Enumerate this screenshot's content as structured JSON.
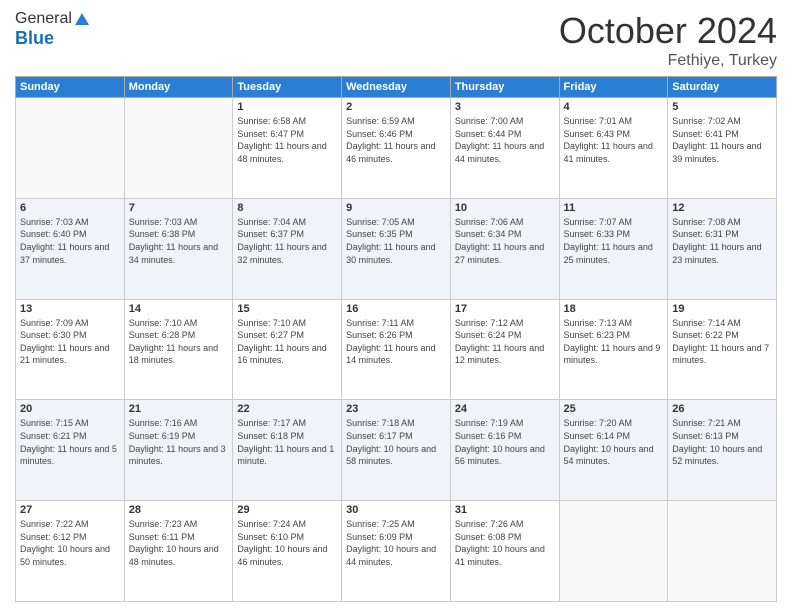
{
  "logo": {
    "line1": "General",
    "line2": "Blue"
  },
  "header": {
    "month": "October 2024",
    "location": "Fethiye, Turkey"
  },
  "weekdays": [
    "Sunday",
    "Monday",
    "Tuesday",
    "Wednesday",
    "Thursday",
    "Friday",
    "Saturday"
  ],
  "weeks": [
    [
      {
        "day": "",
        "info": ""
      },
      {
        "day": "",
        "info": ""
      },
      {
        "day": "1",
        "info": "Sunrise: 6:58 AM\nSunset: 6:47 PM\nDaylight: 11 hours and 48 minutes."
      },
      {
        "day": "2",
        "info": "Sunrise: 6:59 AM\nSunset: 6:46 PM\nDaylight: 11 hours and 46 minutes."
      },
      {
        "day": "3",
        "info": "Sunrise: 7:00 AM\nSunset: 6:44 PM\nDaylight: 11 hours and 44 minutes."
      },
      {
        "day": "4",
        "info": "Sunrise: 7:01 AM\nSunset: 6:43 PM\nDaylight: 11 hours and 41 minutes."
      },
      {
        "day": "5",
        "info": "Sunrise: 7:02 AM\nSunset: 6:41 PM\nDaylight: 11 hours and 39 minutes."
      }
    ],
    [
      {
        "day": "6",
        "info": "Sunrise: 7:03 AM\nSunset: 6:40 PM\nDaylight: 11 hours and 37 minutes."
      },
      {
        "day": "7",
        "info": "Sunrise: 7:03 AM\nSunset: 6:38 PM\nDaylight: 11 hours and 34 minutes."
      },
      {
        "day": "8",
        "info": "Sunrise: 7:04 AM\nSunset: 6:37 PM\nDaylight: 11 hours and 32 minutes."
      },
      {
        "day": "9",
        "info": "Sunrise: 7:05 AM\nSunset: 6:35 PM\nDaylight: 11 hours and 30 minutes."
      },
      {
        "day": "10",
        "info": "Sunrise: 7:06 AM\nSunset: 6:34 PM\nDaylight: 11 hours and 27 minutes."
      },
      {
        "day": "11",
        "info": "Sunrise: 7:07 AM\nSunset: 6:33 PM\nDaylight: 11 hours and 25 minutes."
      },
      {
        "day": "12",
        "info": "Sunrise: 7:08 AM\nSunset: 6:31 PM\nDaylight: 11 hours and 23 minutes."
      }
    ],
    [
      {
        "day": "13",
        "info": "Sunrise: 7:09 AM\nSunset: 6:30 PM\nDaylight: 11 hours and 21 minutes."
      },
      {
        "day": "14",
        "info": "Sunrise: 7:10 AM\nSunset: 6:28 PM\nDaylight: 11 hours and 18 minutes."
      },
      {
        "day": "15",
        "info": "Sunrise: 7:10 AM\nSunset: 6:27 PM\nDaylight: 11 hours and 16 minutes."
      },
      {
        "day": "16",
        "info": "Sunrise: 7:11 AM\nSunset: 6:26 PM\nDaylight: 11 hours and 14 minutes."
      },
      {
        "day": "17",
        "info": "Sunrise: 7:12 AM\nSunset: 6:24 PM\nDaylight: 11 hours and 12 minutes."
      },
      {
        "day": "18",
        "info": "Sunrise: 7:13 AM\nSunset: 6:23 PM\nDaylight: 11 hours and 9 minutes."
      },
      {
        "day": "19",
        "info": "Sunrise: 7:14 AM\nSunset: 6:22 PM\nDaylight: 11 hours and 7 minutes."
      }
    ],
    [
      {
        "day": "20",
        "info": "Sunrise: 7:15 AM\nSunset: 6:21 PM\nDaylight: 11 hours and 5 minutes."
      },
      {
        "day": "21",
        "info": "Sunrise: 7:16 AM\nSunset: 6:19 PM\nDaylight: 11 hours and 3 minutes."
      },
      {
        "day": "22",
        "info": "Sunrise: 7:17 AM\nSunset: 6:18 PM\nDaylight: 11 hours and 1 minute."
      },
      {
        "day": "23",
        "info": "Sunrise: 7:18 AM\nSunset: 6:17 PM\nDaylight: 10 hours and 58 minutes."
      },
      {
        "day": "24",
        "info": "Sunrise: 7:19 AM\nSunset: 6:16 PM\nDaylight: 10 hours and 56 minutes."
      },
      {
        "day": "25",
        "info": "Sunrise: 7:20 AM\nSunset: 6:14 PM\nDaylight: 10 hours and 54 minutes."
      },
      {
        "day": "26",
        "info": "Sunrise: 7:21 AM\nSunset: 6:13 PM\nDaylight: 10 hours and 52 minutes."
      }
    ],
    [
      {
        "day": "27",
        "info": "Sunrise: 7:22 AM\nSunset: 6:12 PM\nDaylight: 10 hours and 50 minutes."
      },
      {
        "day": "28",
        "info": "Sunrise: 7:23 AM\nSunset: 6:11 PM\nDaylight: 10 hours and 48 minutes."
      },
      {
        "day": "29",
        "info": "Sunrise: 7:24 AM\nSunset: 6:10 PM\nDaylight: 10 hours and 46 minutes."
      },
      {
        "day": "30",
        "info": "Sunrise: 7:25 AM\nSunset: 6:09 PM\nDaylight: 10 hours and 44 minutes."
      },
      {
        "day": "31",
        "info": "Sunrise: 7:26 AM\nSunset: 6:08 PM\nDaylight: 10 hours and 41 minutes."
      },
      {
        "day": "",
        "info": ""
      },
      {
        "day": "",
        "info": ""
      }
    ]
  ]
}
